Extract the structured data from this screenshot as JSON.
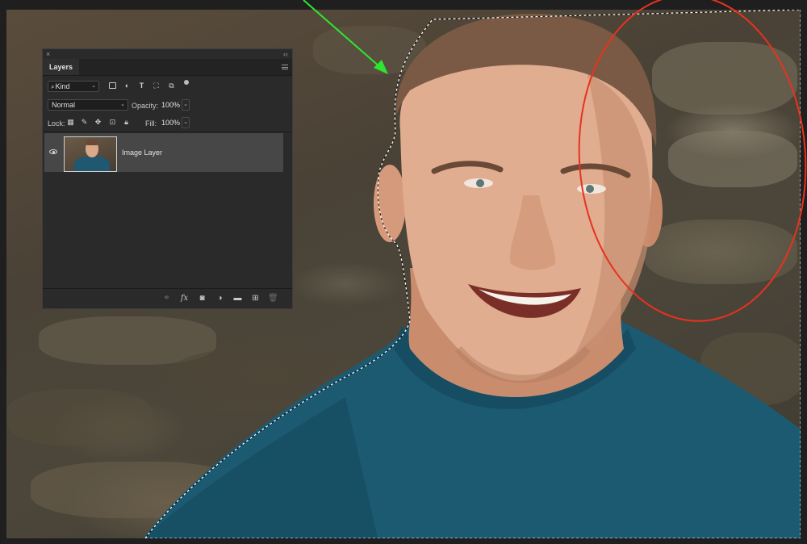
{
  "panel": {
    "close_glyph": "×",
    "collapse_glyph": "‹‹",
    "tab_label": "Layers",
    "menu_icon": "panel-menu-icon",
    "filter": {
      "kind_label": "Kind",
      "icons": [
        "pixel-filter-icon",
        "adjustment-filter-icon",
        "type-filter-icon",
        "shape-filter-icon",
        "smart-object-filter-icon"
      ]
    },
    "blend_mode": "Normal",
    "opacity_label": "Opacity:",
    "opacity_value": "100%",
    "lock_label": "Lock:",
    "fill_label": "Fill:",
    "fill_value": "100%",
    "layers": [
      {
        "name": "Image Layer",
        "visible": true
      }
    ],
    "bottom_icons": [
      "link-icon",
      "fx-icon",
      "mask-icon",
      "adjustment-icon",
      "group-folder-icon",
      "new-layer-icon",
      "trash-icon"
    ],
    "fx_label": "fx"
  },
  "annotations": {
    "arrow_color": "#2ee62e",
    "circle_color": "#e8321e",
    "selection": "marching-ants"
  }
}
